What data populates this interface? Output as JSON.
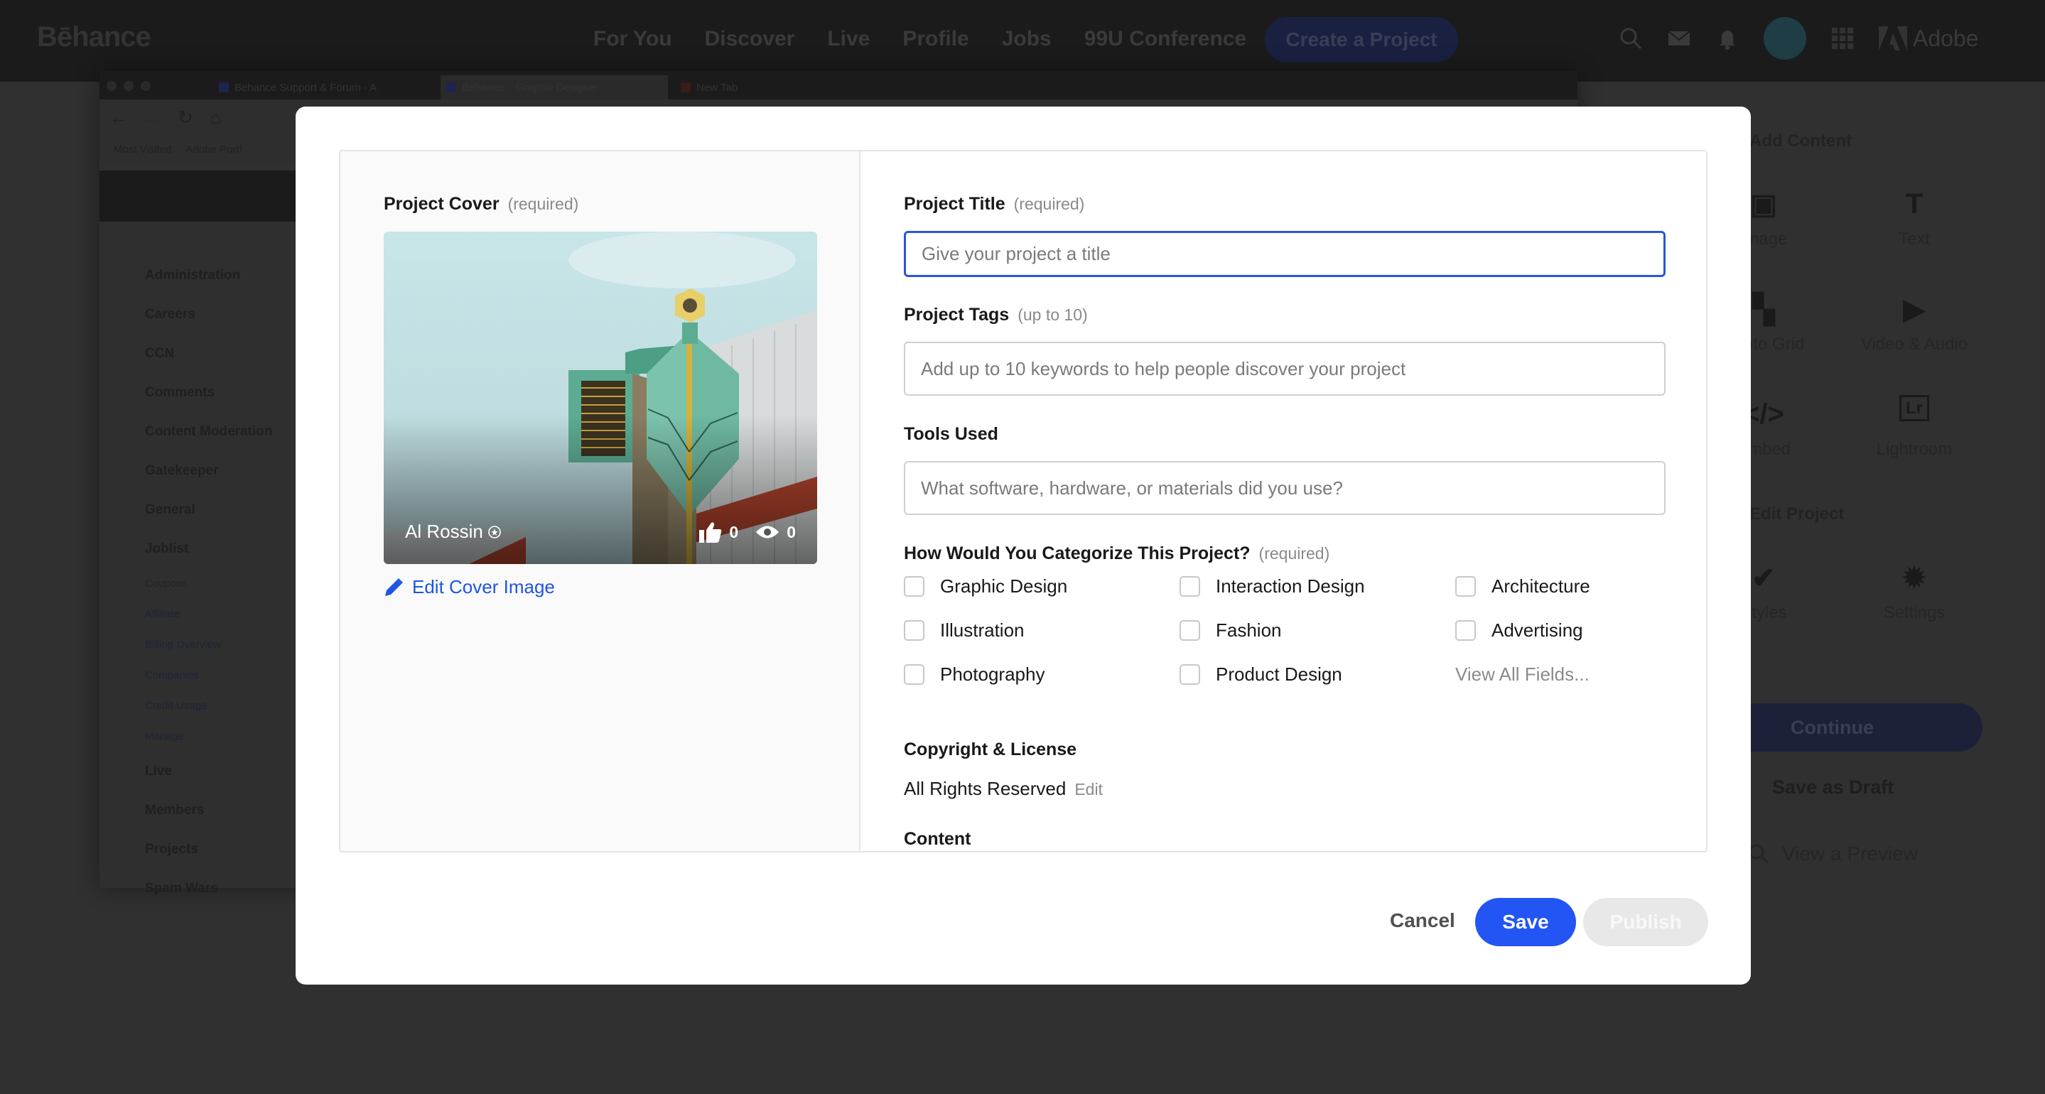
{
  "topnav": {
    "logo": "Bēhance",
    "links": [
      "For You",
      "Discover",
      "Live",
      "Profile",
      "Jobs",
      "99U Conference"
    ],
    "create_button": "Create a Project",
    "adobe_label": "Adobe",
    "icons": [
      "search-icon",
      "mail-icon",
      "bell-icon",
      "avatar",
      "apps-grid-icon",
      "adobe-logo-icon"
    ]
  },
  "background_browser": {
    "tabs": [
      {
        "title": "Behance Support & Forum - A",
        "active": false
      },
      {
        "title": "Behance :: Graphic Designer",
        "active": true
      },
      {
        "title": "New Tab",
        "active": false
      }
    ],
    "bookmarks": [
      "Most Visited",
      "Adobe Portf"
    ],
    "sidebar": {
      "items": [
        {
          "label": "Administration",
          "type": "main"
        },
        {
          "label": "Careers",
          "type": "main"
        },
        {
          "label": "CCN",
          "type": "main"
        },
        {
          "label": "Comments",
          "type": "main"
        },
        {
          "label": "Content Moderation",
          "type": "main"
        },
        {
          "label": "Gatekeeper",
          "type": "main"
        },
        {
          "label": "General",
          "type": "main"
        },
        {
          "label": "Joblist",
          "type": "main"
        },
        {
          "label": "Coupons",
          "type": "sub"
        },
        {
          "label": "Affiliate",
          "type": "sub-link"
        },
        {
          "label": "Billing Overview",
          "type": "sub-link"
        },
        {
          "label": "Companies",
          "type": "sub-link"
        },
        {
          "label": "Credit Usage",
          "type": "sub-link"
        },
        {
          "label": "Manage",
          "type": "sub-link"
        },
        {
          "label": "Live",
          "type": "main"
        },
        {
          "label": "Members",
          "type": "main"
        },
        {
          "label": "Projects",
          "type": "main"
        },
        {
          "label": "Spam Wars",
          "type": "main"
        }
      ]
    }
  },
  "right_panel": {
    "heading": "Add Content",
    "tools": [
      {
        "label": "Image",
        "icon": "image-icon"
      },
      {
        "label": "Text",
        "icon": "text-icon"
      },
      {
        "label": "Photo Grid",
        "icon": "grid-icon"
      },
      {
        "label": "Video & Audio",
        "icon": "play-icon"
      },
      {
        "label": "Embed",
        "icon": "code-icon"
      },
      {
        "label": "Lightroom",
        "icon": "lightroom-icon"
      }
    ],
    "section_heading": "Edit Project",
    "tools2": [
      {
        "label": "Styles",
        "icon": "brush-icon"
      },
      {
        "label": "Settings",
        "icon": "gear-icon"
      }
    ],
    "continue_button": "Continue",
    "save_draft_button": "Save as Draft",
    "preview_button": "View a Preview"
  },
  "modal": {
    "cover": {
      "label": "Project Cover",
      "hint": "(required)",
      "owner": "Al Rossin",
      "likes": "0",
      "views": "0",
      "edit_label": "Edit Cover Image"
    },
    "title_field": {
      "label": "Project Title",
      "hint": "(required)",
      "value": "",
      "placeholder": "Give your project a title"
    },
    "tags_field": {
      "label": "Project Tags",
      "hint": "(up to 10)",
      "value": "",
      "placeholder": "Add up to 10 keywords to help people discover your project"
    },
    "tools_field": {
      "label": "Tools Used",
      "value": "",
      "placeholder": "What software, hardware, or materials did you use?"
    },
    "categories": {
      "label": "How Would You Categorize This Project?",
      "hint": "(required)",
      "options": [
        {
          "label": "Graphic Design",
          "checked": false
        },
        {
          "label": "Interaction Design",
          "checked": false
        },
        {
          "label": "Architecture",
          "checked": false
        },
        {
          "label": "Illustration",
          "checked": false
        },
        {
          "label": "Fashion",
          "checked": false
        },
        {
          "label": "Advertising",
          "checked": false
        },
        {
          "label": "Photography",
          "checked": false
        },
        {
          "label": "Product Design",
          "checked": false
        }
      ],
      "view_all": "View All Fields..."
    },
    "license": {
      "label": "Copyright & License",
      "value": "All Rights Reserved",
      "edit": "Edit"
    },
    "content_label": "Content",
    "buttons": {
      "cancel": "Cancel",
      "save": "Save",
      "publish": "Publish"
    }
  },
  "colors": {
    "accent": "#2255f4",
    "link": "#1f55e6",
    "focus_border": "#2857d9",
    "disabled_button": "#e8e8e8"
  }
}
